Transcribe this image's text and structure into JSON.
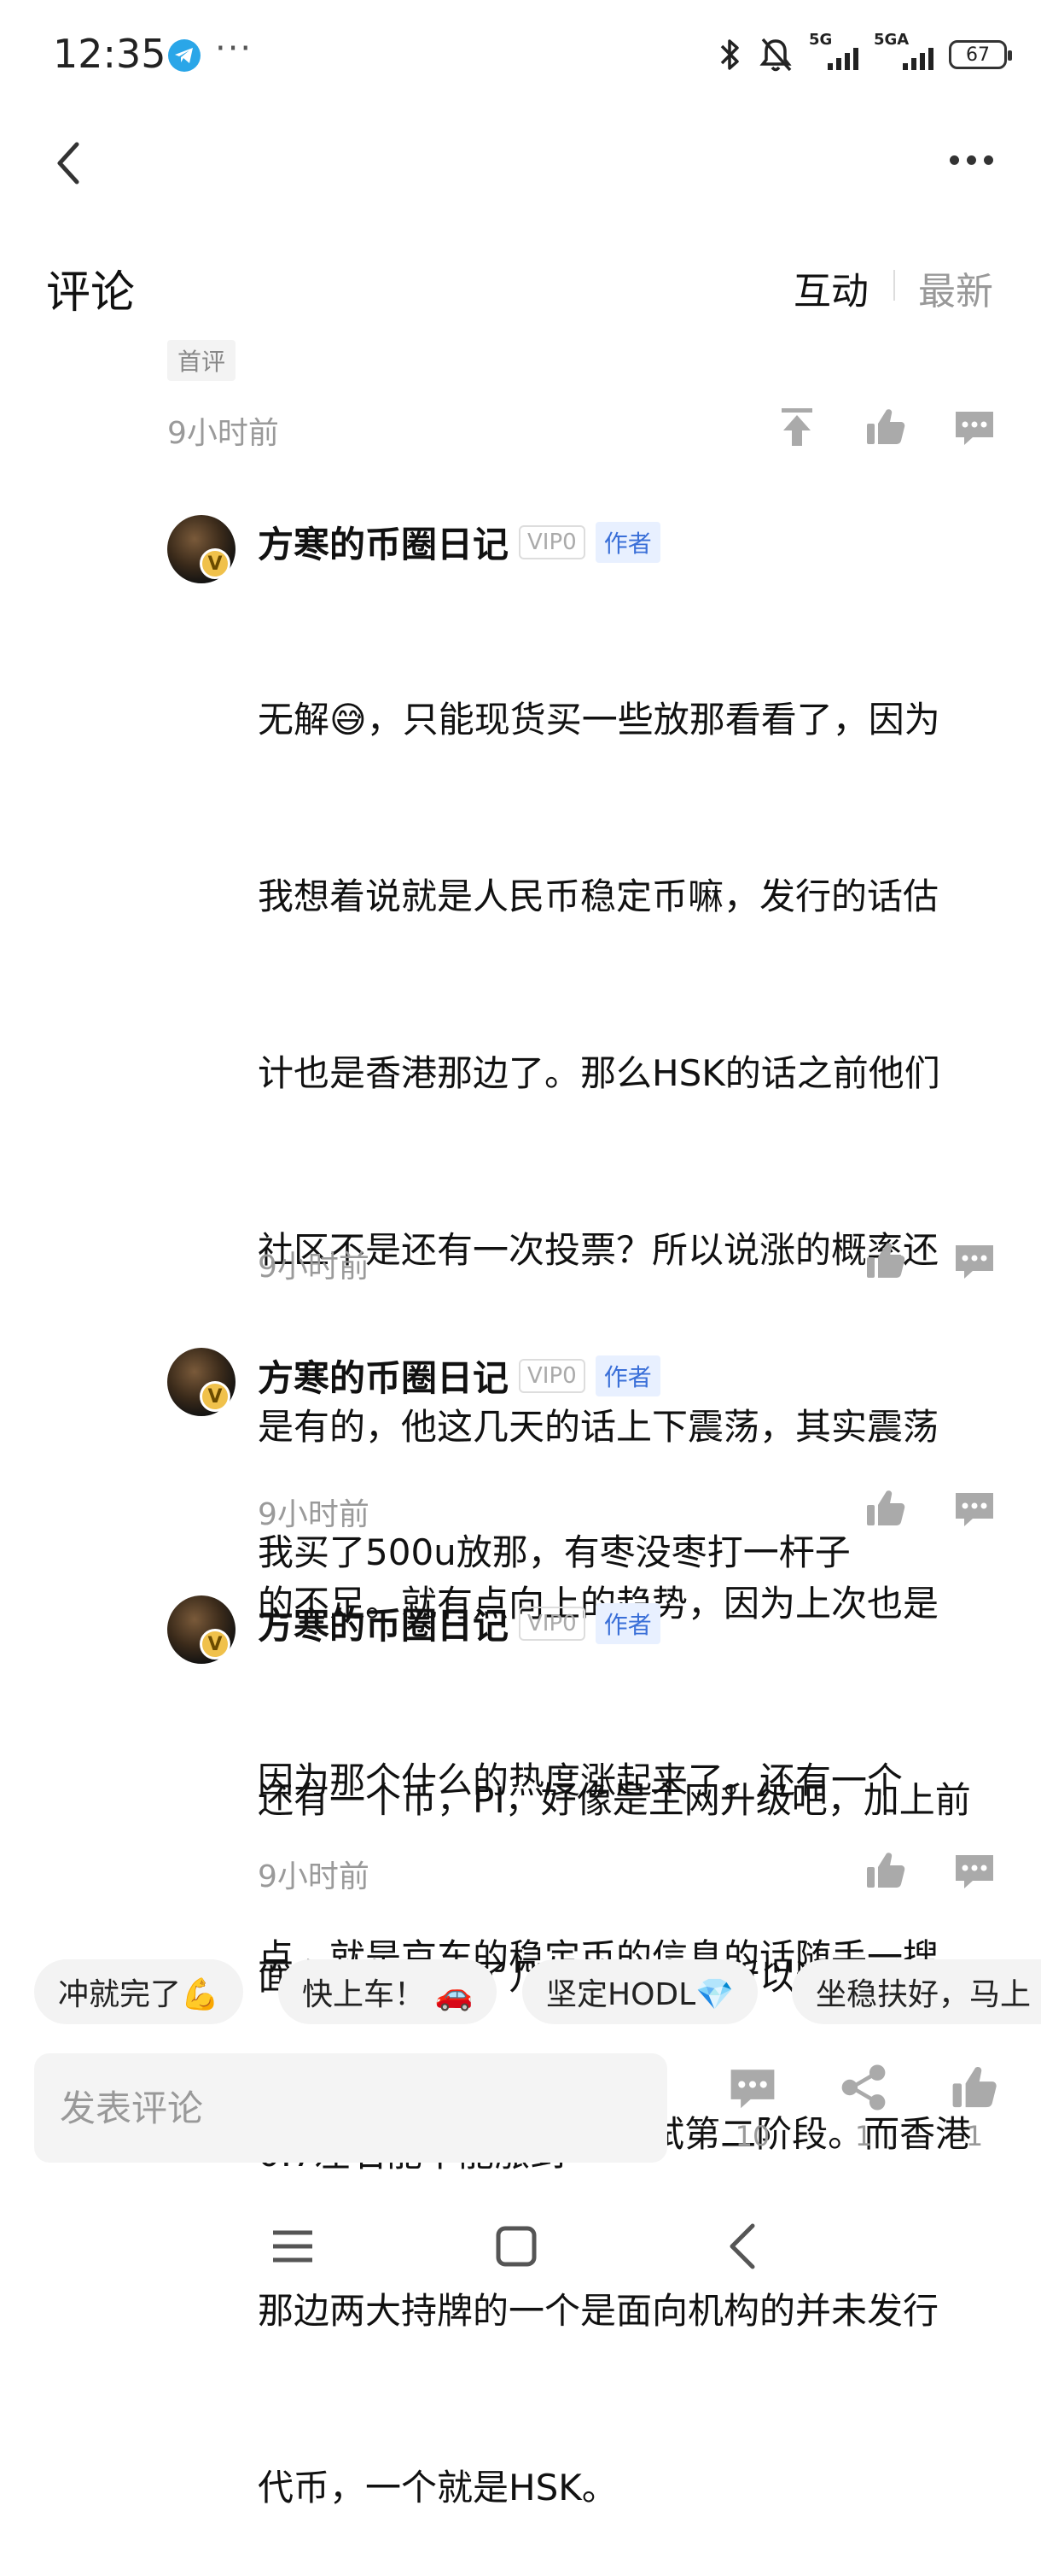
{
  "status_bar": {
    "time": "12:35",
    "more_dots": "···",
    "net1": "5G",
    "net2": "5GA",
    "battery": "67"
  },
  "header": {
    "title": "评论",
    "tabs": [
      {
        "label": "互动",
        "active": true
      },
      {
        "label": "最新",
        "active": false
      }
    ]
  },
  "first_comment_tail": {
    "badge": "首评",
    "time": "9小时前"
  },
  "replies": [
    {
      "user": "方寒的币圈日记",
      "vip": "VIP0",
      "role": "作者",
      "lines": [
        "无解😅，只能现货买一些放那看看了，因为",
        "我想着说就是人民币稳定币嘛，发行的话估",
        "计也是香港那边了。那么HSK的话之前他们",
        "社区不是还有一次投票？所以说涨的概率还",
        "是有的，他这几天的话上下震荡，其实震荡",
        "的不足。就有点向上的趋势，因为上次也是",
        "因为那个什么的热度涨起来了。还有一个",
        "点，就是京东的稳定币的信息的话随手一搜",
        "就能搜到8月28日沙盒测试第二阶段。而香港",
        "那边两大持牌的一个是面向机构的并未发行",
        "代币，一个就是HSK。"
      ],
      "time": "9小时前"
    },
    {
      "user": "方寒的币圈日记",
      "vip": "VIP0",
      "role": "作者",
      "lines": [
        "我买了500u放那，有枣没枣打一杆子"
      ],
      "time": "9小时前"
    },
    {
      "user": "方寒的币圈日记",
      "vip": "VIP0",
      "role": "作者",
      "lines": [
        "还有一个币，PI，好像是主网升级吧，加上前",
        "面有个巨鲸买了几亿的消息，所以这波看看",
        "0.7左右能不能涨到"
      ],
      "time": "9小时前"
    }
  ],
  "quick_replies": [
    "冲就完了💪",
    "快上车！ 🚗",
    "坚定HODL💎",
    "坐稳扶好，马上"
  ],
  "bottom_bar": {
    "input_placeholder": "发表评论",
    "comment_count": "10",
    "share_count": "1",
    "like_count": "1"
  },
  "icons": {
    "back": "chevron-left-icon",
    "more": "more-horizontal-icon",
    "pin": "pin-top-icon",
    "like": "thumb-up-icon",
    "comment": "comment-bubble-icon",
    "share": "share-icon"
  },
  "colors": {
    "author_badge": "#3a6fd8",
    "avatar_badge": "#f0c14b",
    "muted_text": "#9a9a9a"
  }
}
